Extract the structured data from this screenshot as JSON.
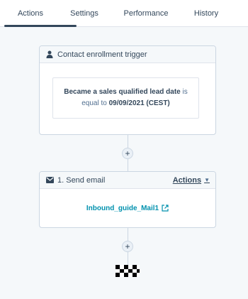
{
  "tabs": [
    {
      "label": "Actions",
      "active": true
    },
    {
      "label": "Settings",
      "active": false
    },
    {
      "label": "Performance",
      "active": false
    },
    {
      "label": "History",
      "active": false
    }
  ],
  "trigger": {
    "header": "Contact enrollment trigger",
    "icon": "person-icon",
    "condition_field": "Became a sales qualified lead date",
    "condition_op": "is equal to",
    "condition_value": "09/09/2021 (CEST)"
  },
  "action_step": {
    "header": "1. Send email",
    "icon": "envelope-icon",
    "actions_label": "Actions",
    "email_name": "Inbound_guide_Mail1"
  },
  "add_button": {
    "label": "+"
  },
  "colors": {
    "accent": "#0091ae",
    "text": "#33475b",
    "border": "#cbd6e2",
    "background": "#f5f8fa"
  }
}
